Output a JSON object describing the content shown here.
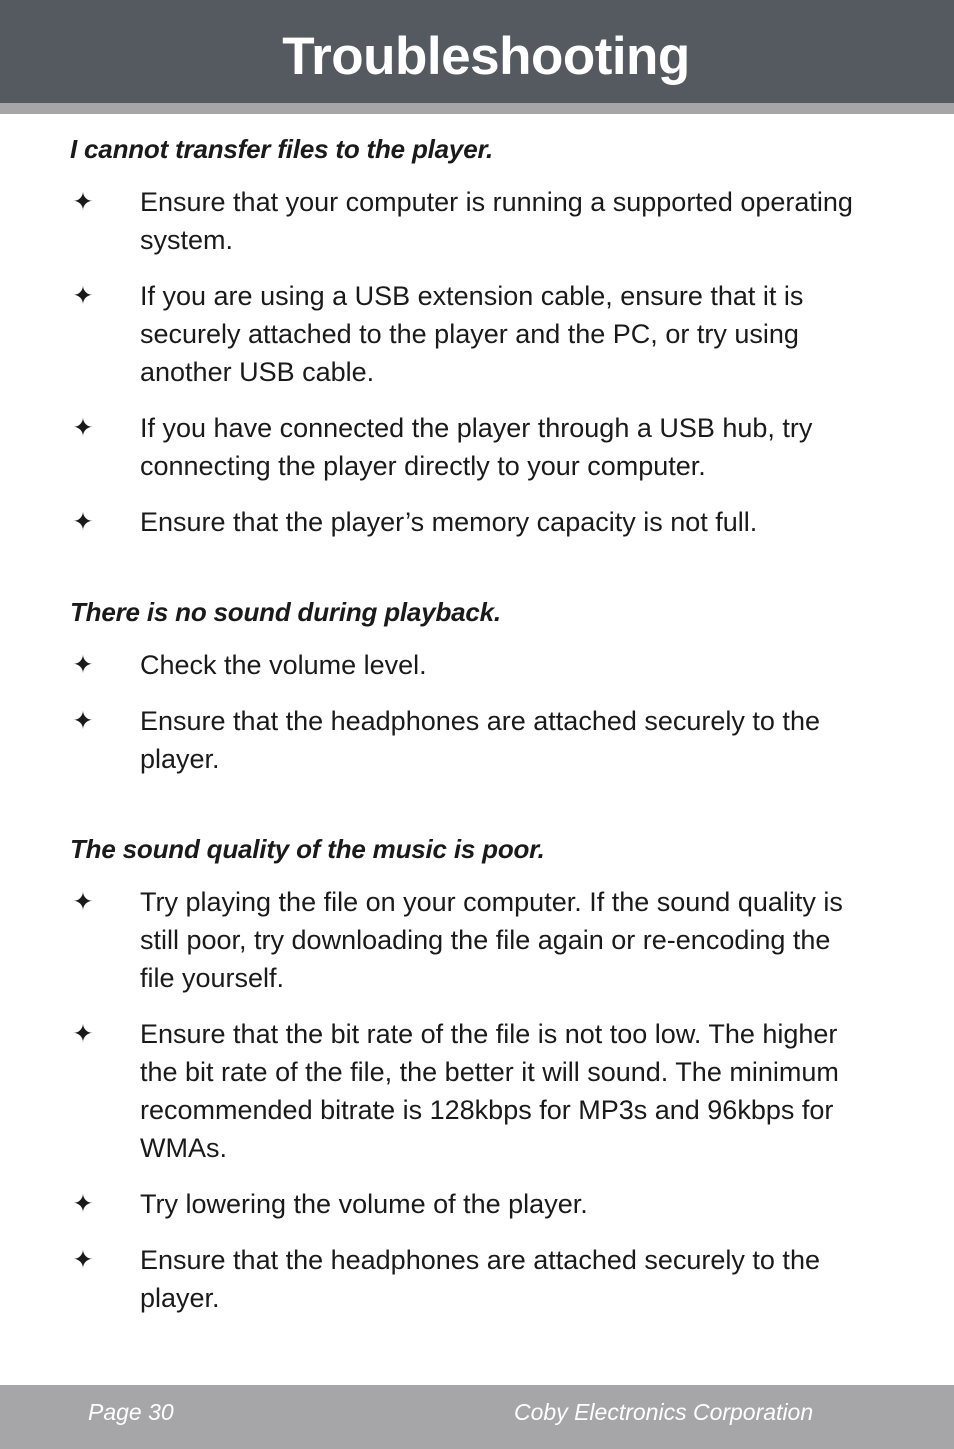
{
  "header": {
    "title": "Troubleshooting"
  },
  "bullet_icon": "✦",
  "sections": [
    {
      "heading": "I cannot transfer files to the player.",
      "bullets": [
        "Ensure that your computer is running a supported operating system.",
        "If you are using a USB extension cable, ensure that it is securely attached to the player and the PC, or try using another USB cable.",
        "If you have connected the player through a USB hub, try connecting the player directly to your computer.",
        "Ensure that the player’s memory capacity is not full."
      ]
    },
    {
      "heading": "There is no sound during playback.",
      "bullets": [
        "Check the volume level.",
        "Ensure that the headphones are attached securely to the player."
      ]
    },
    {
      "heading": "The sound quality of the music is poor.",
      "bullets": [
        "Try playing the file on your computer. If the sound quality is still poor, try downloading the file again or re-encoding the file yourself.",
        "Ensure that the bit rate of the file is not too low. The higher the bit rate of the file, the better it will sound. The minimum recommended bitrate is 128kbps for MP3s and 96kbps for WMAs.",
        "Try lowering the volume of the player.",
        "Ensure that the headphones are attached securely to the player."
      ]
    }
  ],
  "footer": {
    "page_label": "Page 30",
    "company": "Coby Electronics Corporation"
  },
  "colors": {
    "header_bg": "#555a60",
    "rule_bg": "#a6a6a8",
    "footer_bg": "#a6a6a8",
    "text": "#1a1a1a",
    "header_text": "#ffffff"
  }
}
